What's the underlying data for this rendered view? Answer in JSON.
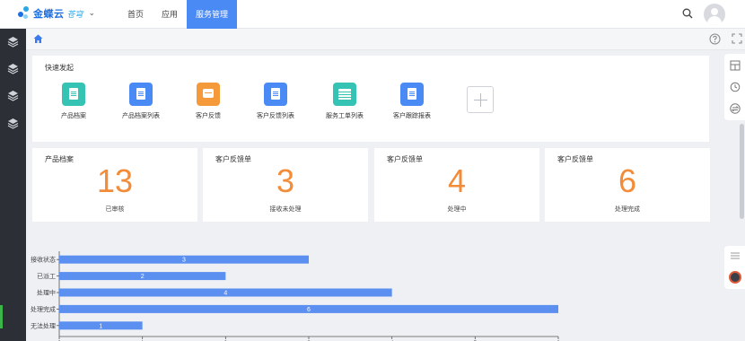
{
  "header": {
    "logo_text": "金蝶云",
    "logo_sub": "苍穹",
    "nav": [
      "首页",
      "应用",
      "服务管理"
    ],
    "active_nav": 2
  },
  "quick_entry": {
    "title": "快速发起",
    "items": [
      {
        "label": "产品档案",
        "color": "#35c3b3"
      },
      {
        "label": "产品档案列表",
        "color": "#4a8af4"
      },
      {
        "label": "客户反馈",
        "color": "#f59a3b"
      },
      {
        "label": "客户反馈列表",
        "color": "#4a8af4"
      },
      {
        "label": "服务工单列表",
        "color": "#35c3b3"
      },
      {
        "label": "客户跟踪报表",
        "color": "#4a8af4"
      }
    ]
  },
  "stats": [
    {
      "title": "产品档案",
      "value": "13",
      "sub": "已审核"
    },
    {
      "title": "客户反馈单",
      "value": "3",
      "sub": "接收未处理"
    },
    {
      "title": "客户反馈单",
      "value": "4",
      "sub": "处理中"
    },
    {
      "title": "客户反馈单",
      "value": "6",
      "sub": "处理完成"
    }
  ],
  "colors": {
    "accent": "#4a8af4",
    "stat_number": "#f28c38",
    "bar": "#5b8ff0"
  },
  "chart_data": {
    "type": "bar",
    "orientation": "horizontal",
    "categories": [
      "接收状态",
      "已派工",
      "处理中",
      "处理完成",
      "无法处理"
    ],
    "values": [
      3,
      2,
      4,
      6,
      1
    ],
    "xlim": [
      0,
      6
    ],
    "xticks": [
      0,
      1,
      2,
      3,
      4,
      5,
      6
    ],
    "data_labels": true
  }
}
